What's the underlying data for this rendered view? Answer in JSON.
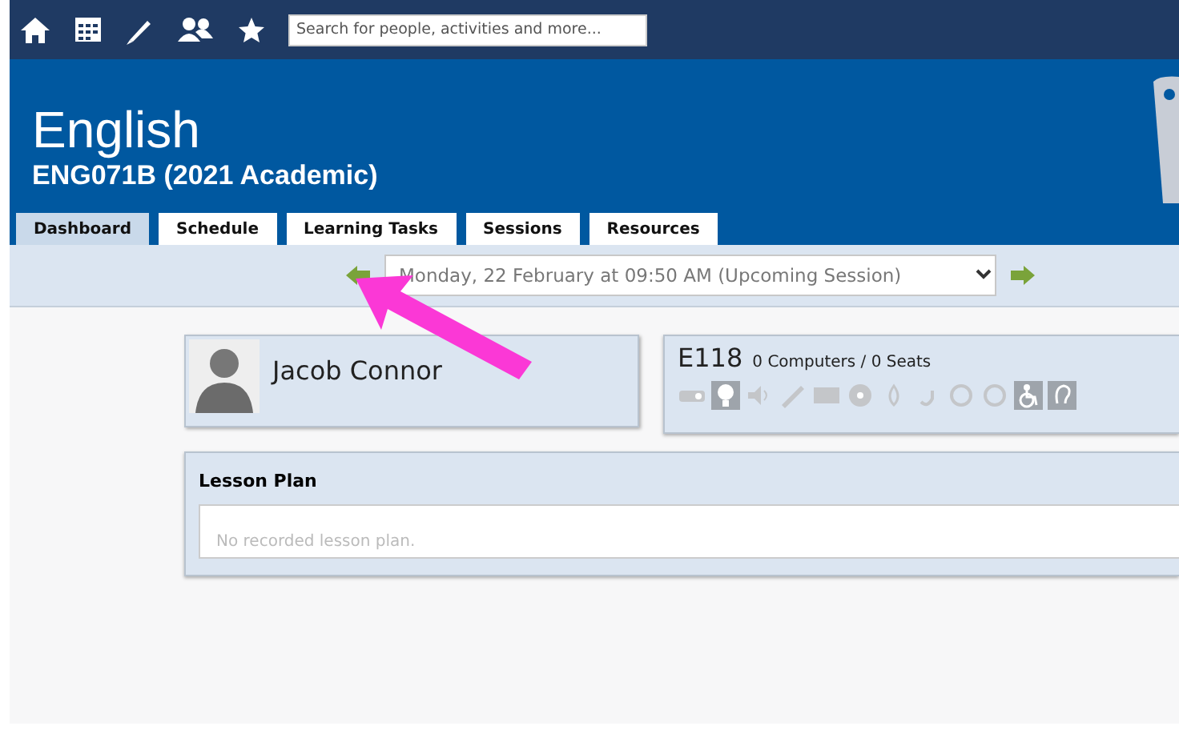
{
  "toolbar": {
    "search": {
      "placeholder": "Search for people, activities and more..."
    }
  },
  "header": {
    "title": "English",
    "subtitle": "ENG071B (2021 Academic)"
  },
  "tabs": [
    {
      "label": "Dashboard",
      "selected": true
    },
    {
      "label": "Schedule",
      "selected": false
    },
    {
      "label": "Learning Tasks",
      "selected": false
    },
    {
      "label": "Sessions",
      "selected": false
    },
    {
      "label": "Resources",
      "selected": false
    }
  ],
  "session": {
    "value": "Monday, 22 February at 09:50 AM (Upcoming Session)"
  },
  "teacher": {
    "name": "Jacob Connor"
  },
  "room": {
    "name": "E118",
    "capacity": "0 Computers / 0 Seats",
    "facilities": [
      {
        "kind": "projector",
        "available": false
      },
      {
        "kind": "bulb",
        "available": true
      },
      {
        "kind": "speaker",
        "available": false
      },
      {
        "kind": "pen",
        "available": false
      },
      {
        "kind": "board",
        "available": false
      },
      {
        "kind": "disc",
        "available": false
      },
      {
        "kind": "drop",
        "available": false
      },
      {
        "kind": "hook",
        "available": false
      },
      {
        "kind": "ring",
        "available": false
      },
      {
        "kind": "ring",
        "available": false
      },
      {
        "kind": "wheelchair",
        "available": true
      },
      {
        "kind": "ear",
        "available": true
      }
    ]
  },
  "lesson_plan": {
    "title": "Lesson Plan",
    "text": "No recorded lesson plan."
  }
}
